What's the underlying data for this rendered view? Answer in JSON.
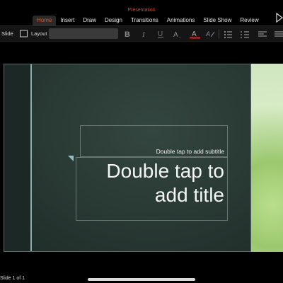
{
  "app": {
    "title": "Presentation"
  },
  "tabs": [
    {
      "label": "Home",
      "active": true
    },
    {
      "label": "Insert"
    },
    {
      "label": "Draw"
    },
    {
      "label": "Design"
    },
    {
      "label": "Transitions"
    },
    {
      "label": "Animations"
    },
    {
      "label": "Slide Show"
    },
    {
      "label": "Review"
    }
  ],
  "ribbon": {
    "slide_label": "Slide",
    "layout_label": "Layout",
    "font_value": ""
  },
  "slide": {
    "subtitle_placeholder": "Double tap to add subtitle",
    "title_placeholder": "Double tap to add title"
  },
  "status": {
    "slide_counter": "Slide 1 of 1"
  },
  "colors": {
    "accent": "#d9572b",
    "font_color_underline": "#d8222a"
  },
  "icons": [
    "presenter-play-icon",
    "layout-icon",
    "bold-icon",
    "italic-icon",
    "underline-icon",
    "font-size-icon",
    "font-color-icon",
    "highlight-icon",
    "bullets-icon",
    "numbering-icon",
    "align-icon"
  ]
}
